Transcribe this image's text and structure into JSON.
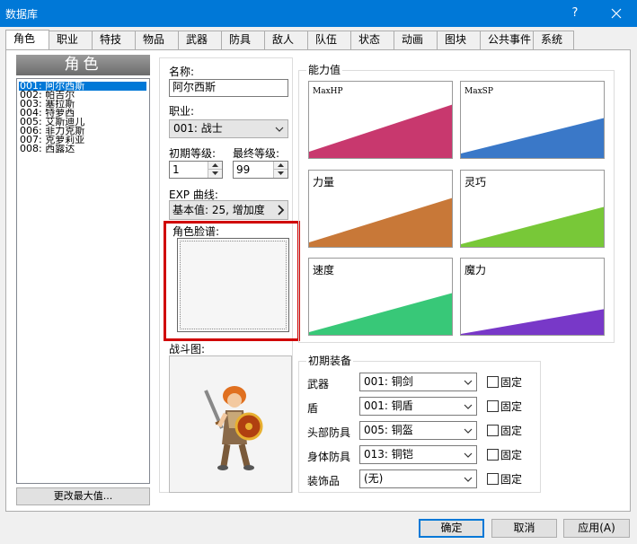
{
  "window": {
    "title": "数据库",
    "help": "?"
  },
  "tabs": [
    "角色",
    "职业",
    "特技",
    "物品",
    "武器",
    "防具",
    "敌人",
    "队伍",
    "状态",
    "动画",
    "图块",
    "公共事件",
    "系统"
  ],
  "actors": {
    "header": "角色",
    "items": [
      "001: 阿尔西斯",
      "002: 帕吉尔",
      "003: 塞拉斯",
      "004: 特萝西",
      "005: 艾斯迪儿",
      "006: 菲力克斯",
      "007: 克萝莉亚",
      "008: 西露达"
    ],
    "change_max_label": "更改最大值..."
  },
  "form": {
    "name_label": "名称:",
    "name_value": "阿尔西斯",
    "class_label": "职业:",
    "class_value": "001: 战士",
    "initial_level_label": "初期等级:",
    "initial_level_value": "1",
    "final_level_label": "最终等级:",
    "final_level_value": "99",
    "exp_label": "EXP 曲线:",
    "exp_value": "基本值: 25, 增加度",
    "face_label": "角色脸谱:",
    "battler_label": "战斗图:"
  },
  "stats": {
    "title": "能力值",
    "items": [
      {
        "label": "MaxHP",
        "color": "#c8386e"
      },
      {
        "label": "MaxSP",
        "color": "#3a78c8"
      },
      {
        "label": "力量",
        "color": "#c87838"
      },
      {
        "label": "灵巧",
        "color": "#78c838"
      },
      {
        "label": "速度",
        "color": "#38c878"
      },
      {
        "label": "魔力",
        "color": "#7838c8"
      }
    ]
  },
  "equipment": {
    "title": "初期装备",
    "fixed_label": "固定",
    "rows": [
      {
        "label": "武器",
        "value": "001: 铜剑"
      },
      {
        "label": "盾",
        "value": "001: 铜盾"
      },
      {
        "label": "头部防具",
        "value": "005: 铜盔"
      },
      {
        "label": "身体防具",
        "value": "013: 铜铠"
      },
      {
        "label": "装饰品",
        "value": "(无)"
      }
    ]
  },
  "buttons": {
    "ok": "确定",
    "cancel": "取消",
    "apply": "应用(A)"
  },
  "colors": {
    "titlebar": "#0078d7",
    "highlight": "#d00000"
  }
}
